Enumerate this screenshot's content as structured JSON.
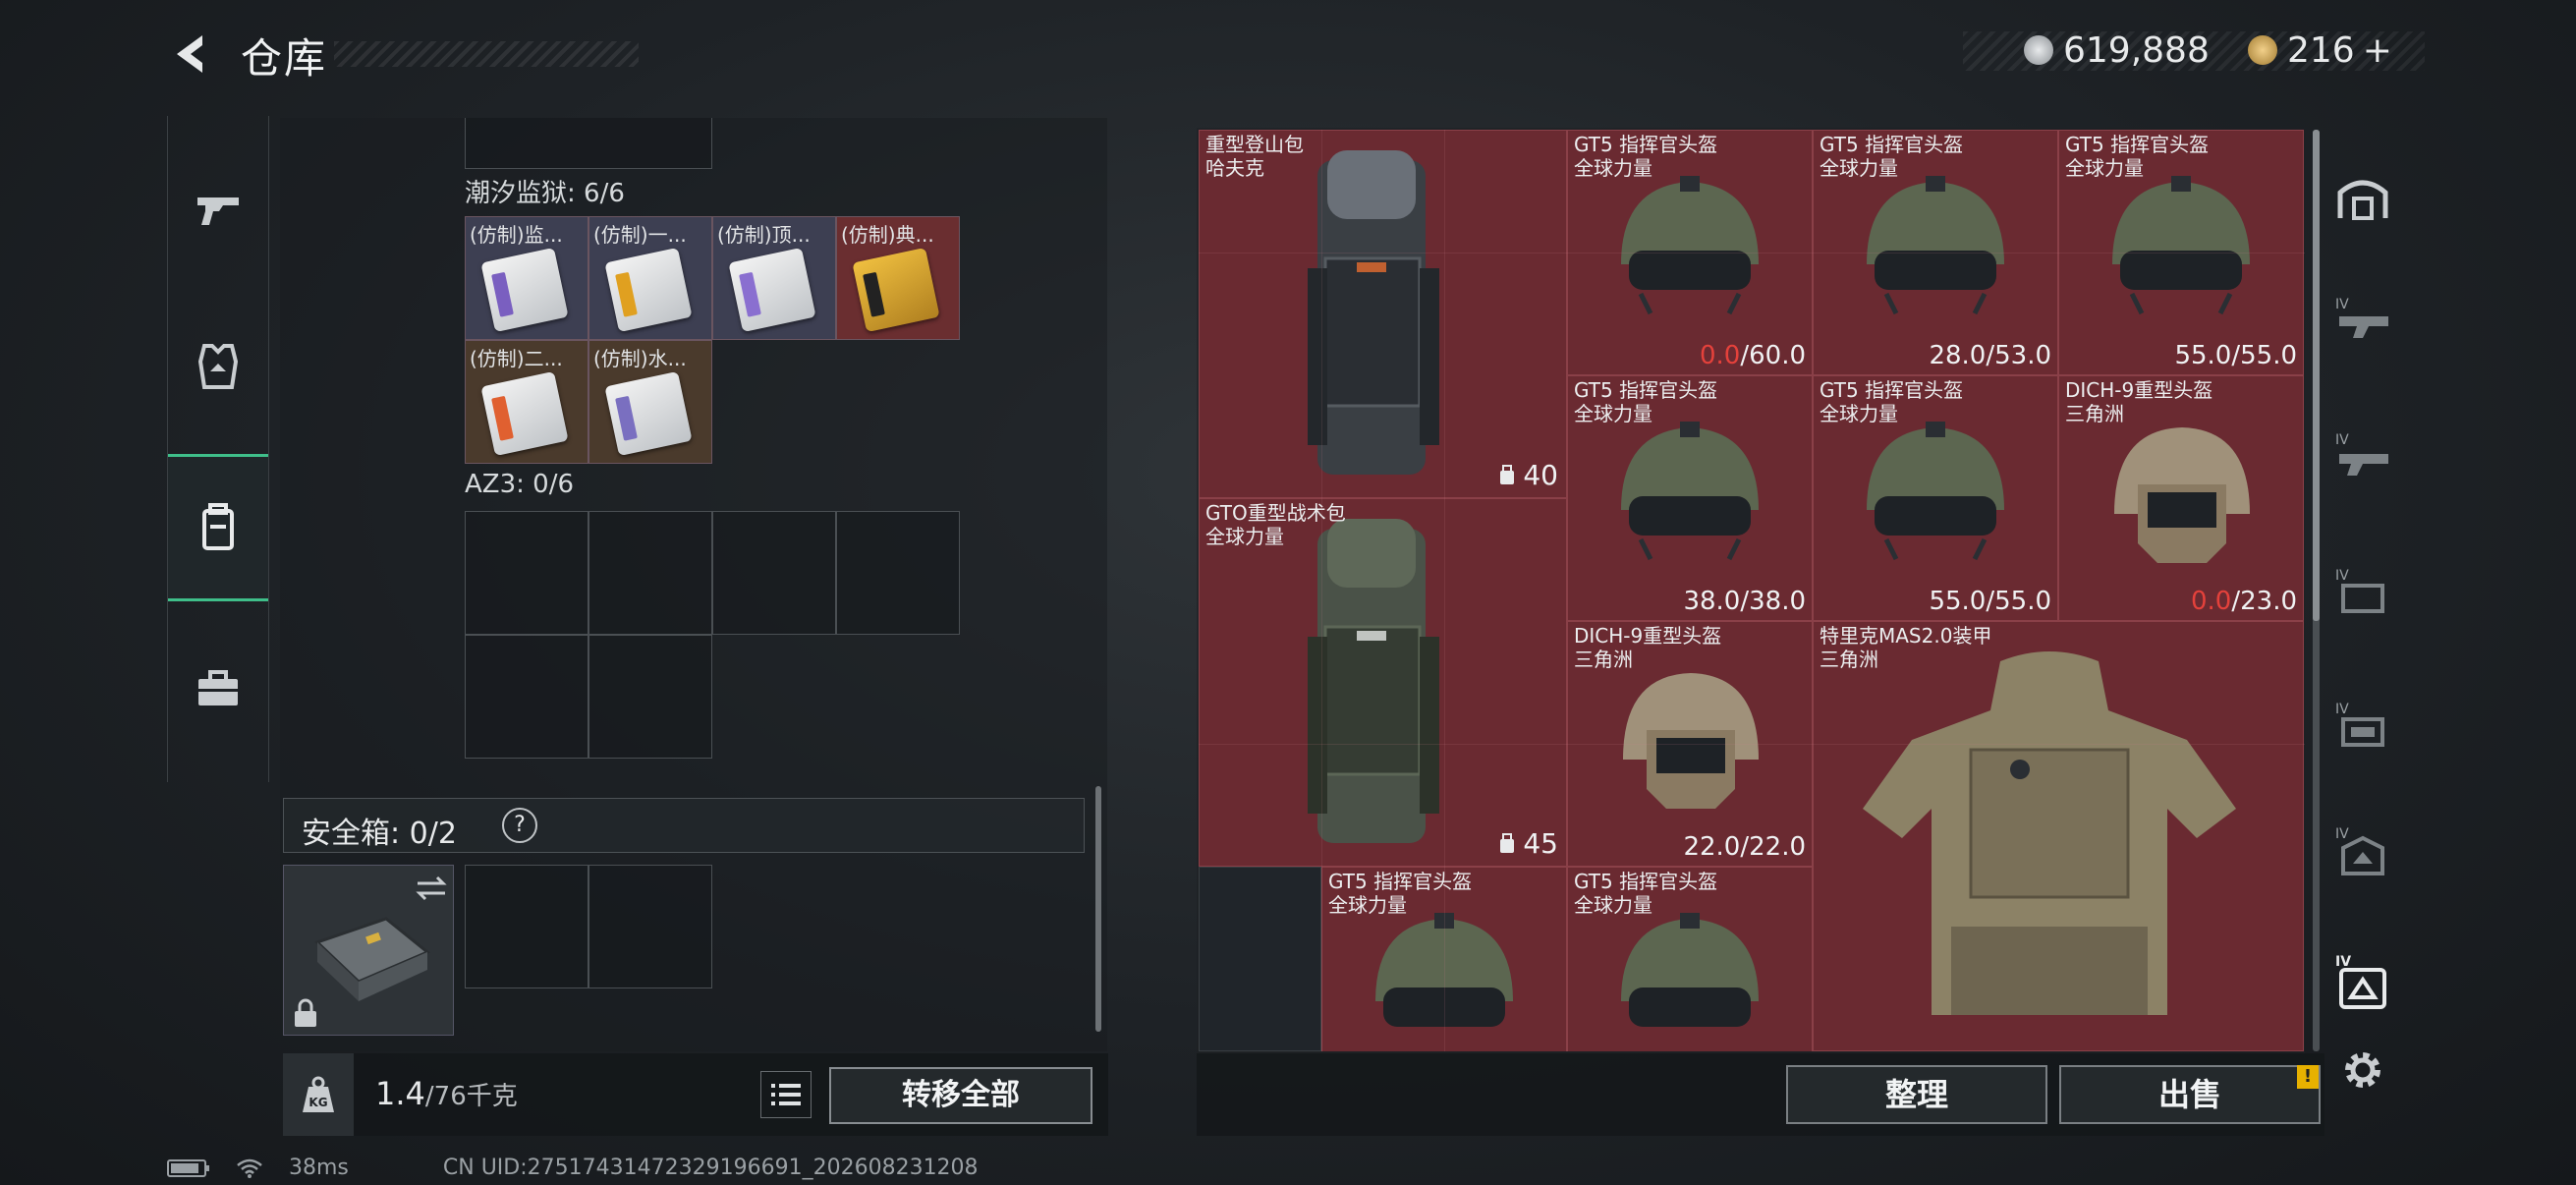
{
  "header": {
    "title": "仓库"
  },
  "currency": {
    "silver": "619,888",
    "gold": "216",
    "add_label": "+"
  },
  "backpack": {
    "sections": [
      {
        "label": "潮汐监狱: 6/6",
        "items": [
          "(仿制)监...",
          "(仿制)一...",
          "(仿制)顶...",
          "(仿制)典...",
          "(仿制)二...",
          "(仿制)水..."
        ]
      },
      {
        "label": "AZ3: 0/6"
      }
    ]
  },
  "safebox": {
    "label": "安全箱: 0/2",
    "help": "?"
  },
  "weight": {
    "current": "1.4",
    "max": "/76千克",
    "kg_label": "KG"
  },
  "buttons": {
    "transfer_all": "转移全部",
    "sort": "整理",
    "sell": "出售",
    "sell_alert": "!"
  },
  "stash": {
    "items": [
      {
        "name": "重型登山包\n哈夫克",
        "capacity": "40"
      },
      {
        "name": "GT5 指挥官头盔\n全球力量",
        "dur_cur": "0.0",
        "dur_max": "/60.0",
        "broken": true
      },
      {
        "name": "GT5 指挥官头盔\n全球力量",
        "dur_cur": "28.0",
        "dur_max": "/53.0",
        "broken": false
      },
      {
        "name": "GT5 指挥官头盔\n全球力量",
        "dur_cur": "55.0",
        "dur_max": "/55.0",
        "broken": false
      },
      {
        "name": "GT5 指挥官头盔\n全球力量",
        "dur_cur": "38.0",
        "dur_max": "/38.0",
        "broken": false
      },
      {
        "name": "GT5 指挥官头盔\n全球力量",
        "dur_cur": "55.0",
        "dur_max": "/55.0",
        "broken": false
      },
      {
        "name": "DICH-9重型头盔\n三角洲",
        "dur_cur": "0.0",
        "dur_max": "/23.0",
        "broken": true
      },
      {
        "name": "GTO重型战术包\n全球力量",
        "capacity": "45"
      },
      {
        "name": "DICH-9重型头盔\n三角洲",
        "dur_cur": "22.0",
        "dur_max": "/22.0",
        "broken": false
      },
      {
        "name": "特里克MAS2.0装甲\n三角洲"
      },
      {
        "name": "GT5 指挥官头盔\n全球力量"
      },
      {
        "name": "GT5 指挥官头盔\n全球力量"
      }
    ]
  },
  "status": {
    "ping": "38ms",
    "uid": "CN UID:27517431472329196691_202608231208"
  }
}
